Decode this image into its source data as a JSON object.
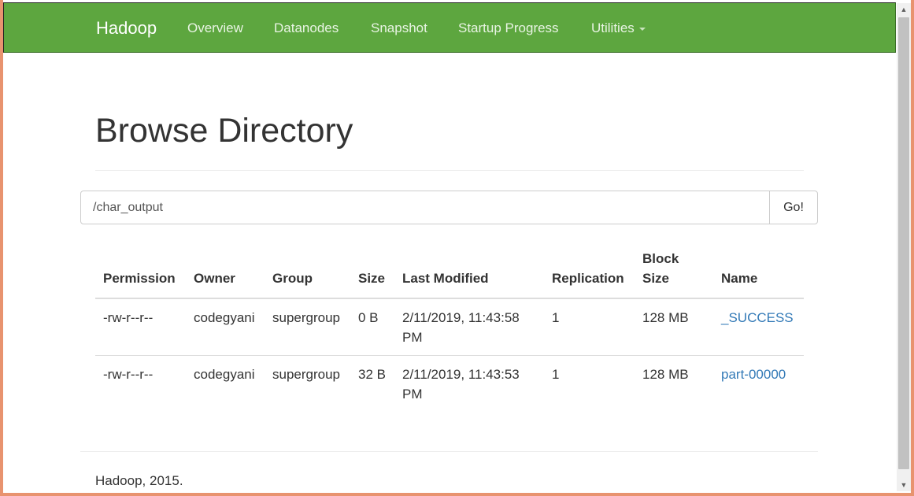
{
  "navbar": {
    "brand": "Hadoop",
    "items": [
      {
        "label": "Overview"
      },
      {
        "label": "Datanodes"
      },
      {
        "label": "Snapshot"
      },
      {
        "label": "Startup Progress"
      },
      {
        "label": "Utilities"
      }
    ]
  },
  "page": {
    "title": "Browse Directory"
  },
  "path_bar": {
    "value": "/char_output",
    "go_label": "Go!"
  },
  "table": {
    "headers": {
      "permission": "Permission",
      "owner": "Owner",
      "group": "Group",
      "size": "Size",
      "last_modified": "Last Modified",
      "replication": "Replication",
      "block_size": "Block Size",
      "name": "Name"
    },
    "rows": [
      {
        "permission": "-rw-r--r--",
        "owner": "codegyani",
        "group": "supergroup",
        "size": "0 B",
        "last_modified": "2/11/2019, 11:43:58 PM",
        "replication": "1",
        "block_size": "128 MB",
        "name": "_SUCCESS"
      },
      {
        "permission": "-rw-r--r--",
        "owner": "codegyani",
        "group": "supergroup",
        "size": "32 B",
        "last_modified": "2/11/2019, 11:43:53 PM",
        "replication": "1",
        "block_size": "128 MB",
        "name": "part-00000"
      }
    ]
  },
  "footer": {
    "text": "Hadoop, 2015."
  },
  "colors": {
    "navbar_bg": "#5da63f",
    "link": "#337ab7",
    "window_border": "#e8936f"
  }
}
